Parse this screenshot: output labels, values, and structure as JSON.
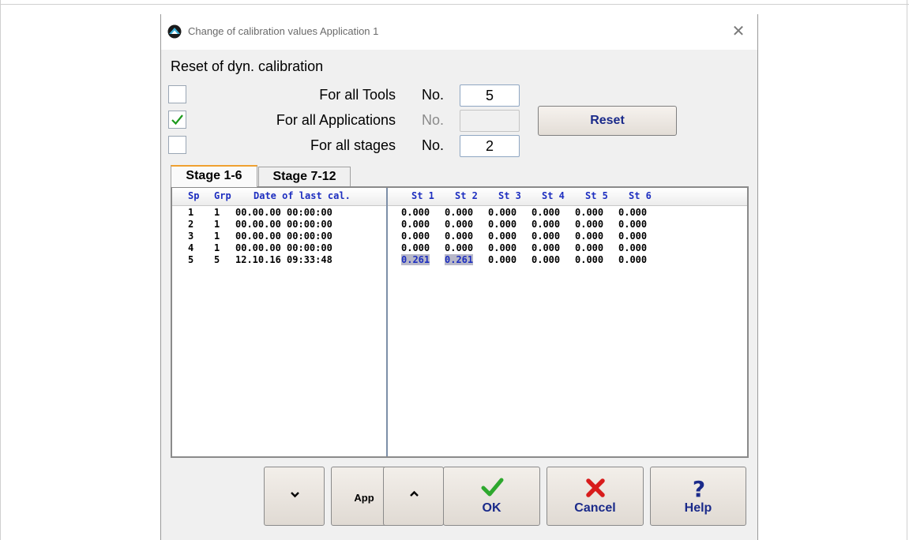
{
  "window": {
    "title": "Change of calibration values  Application 1",
    "close_glyph": "✕"
  },
  "reset_section": {
    "title": "Reset of dyn. calibration",
    "options": [
      {
        "label": "For all Tools",
        "checked": false,
        "no_label": "No.",
        "no_value": "5",
        "enabled": true
      },
      {
        "label": "For all Applications",
        "checked": true,
        "no_label": "No.",
        "no_value": "",
        "enabled": false
      },
      {
        "label": "For all stages",
        "checked": false,
        "no_label": "No.",
        "no_value": "2",
        "enabled": true
      }
    ],
    "reset_button": "Reset"
  },
  "tabs": [
    {
      "label": "Stage 1-6",
      "active": true
    },
    {
      "label": "Stage 7-12",
      "active": false
    }
  ],
  "table": {
    "left_headers": [
      "Sp",
      "Grp",
      "Date of last cal."
    ],
    "right_headers": [
      "St 1",
      "St 2",
      "St 3",
      "St 4",
      "St 5",
      "St 6"
    ],
    "rows": [
      {
        "sp": "1",
        "grp": "1",
        "date": "00.00.00 00:00:00",
        "values": [
          "0.000",
          "0.000",
          "0.000",
          "0.000",
          "0.000",
          "0.000"
        ]
      },
      {
        "sp": "2",
        "grp": "1",
        "date": "00.00.00 00:00:00",
        "values": [
          "0.000",
          "0.000",
          "0.000",
          "0.000",
          "0.000",
          "0.000"
        ]
      },
      {
        "sp": "3",
        "grp": "1",
        "date": "00.00.00 00:00:00",
        "values": [
          "0.000",
          "0.000",
          "0.000",
          "0.000",
          "0.000",
          "0.000"
        ]
      },
      {
        "sp": "4",
        "grp": "1",
        "date": "00.00.00 00:00:00",
        "values": [
          "0.000",
          "0.000",
          "0.000",
          "0.000",
          "0.000",
          "0.000"
        ]
      },
      {
        "sp": "5",
        "grp": "5",
        "date": "12.10.16 09:33:48",
        "values": [
          "0.261",
          "0.261",
          "0.000",
          "0.000",
          "0.000",
          "0.000"
        ],
        "highlighted": [
          0,
          1
        ]
      }
    ]
  },
  "buttons": {
    "down": {
      "icon": "chevron-down-icon"
    },
    "app": {
      "label": "App"
    },
    "up": {
      "icon": "chevron-up-icon"
    },
    "ok": {
      "label": "OK",
      "icon": "check-icon",
      "color": "#2ea82e"
    },
    "cancel": {
      "label": "Cancel",
      "icon": "x-icon",
      "color": "#d81c1c"
    },
    "help": {
      "label": "Help",
      "icon": "question-icon",
      "color": "#1a2a8a"
    }
  }
}
